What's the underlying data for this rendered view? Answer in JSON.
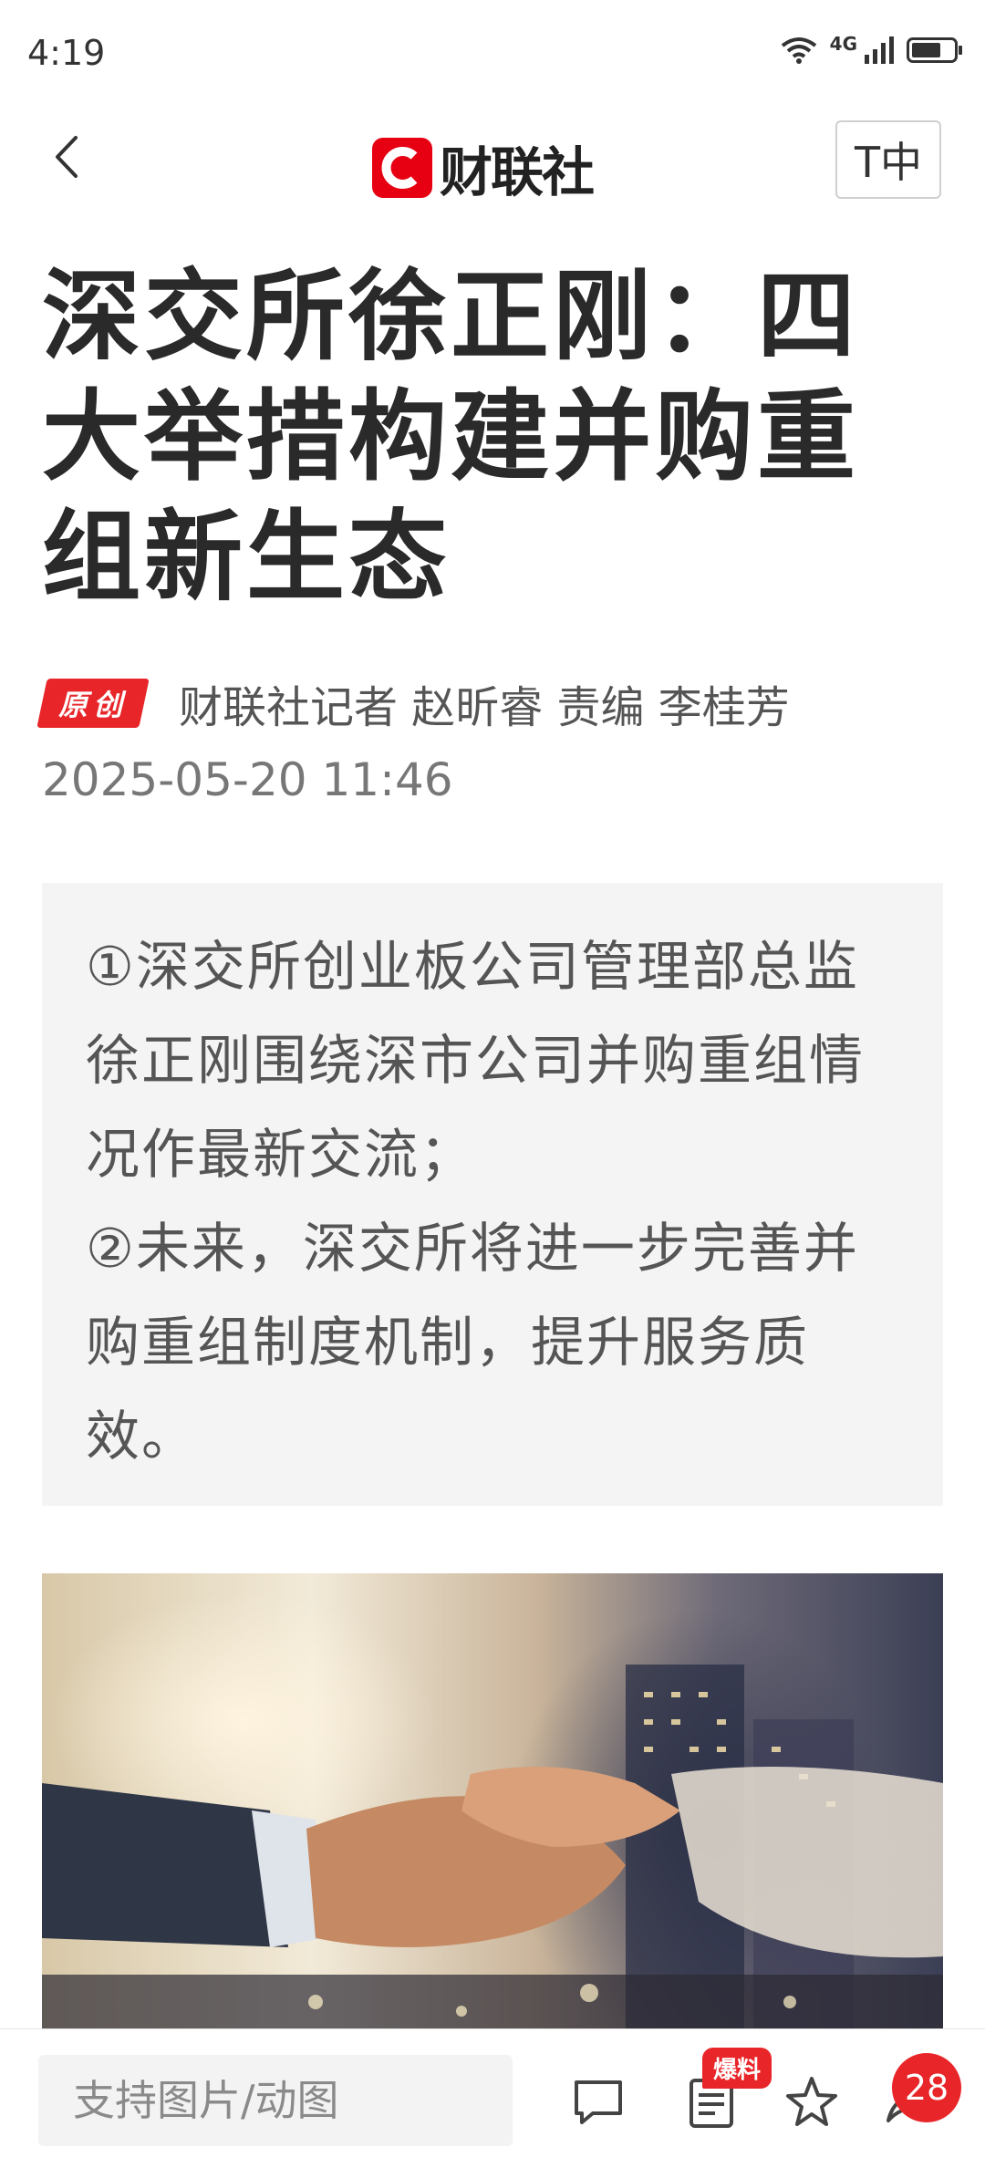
{
  "status_bar": {
    "time": "4:19",
    "network": "4G",
    "battery_level": 0.7
  },
  "header": {
    "logo_text": "财联社",
    "font_size_label": "T中",
    "brand_color": "#e60012"
  },
  "article": {
    "title": "深交所徐正刚：四大举措构建并购重组新生态",
    "badge": "原创",
    "byline": "财联社记者 赵昕睿 责编 李桂芳",
    "date": "2025-05-20 11:46",
    "summary": [
      "①深交所创业板公司管理部总监徐正刚围绕深市公司并购重组情况作最新交流；",
      "②未来，深交所将进一步完善并购重组制度机制，提升服务质效。"
    ]
  },
  "bottom_bar": {
    "comment_placeholder": "支持图片/动图",
    "baoliao_label": "爆料",
    "comment_count": "28"
  }
}
